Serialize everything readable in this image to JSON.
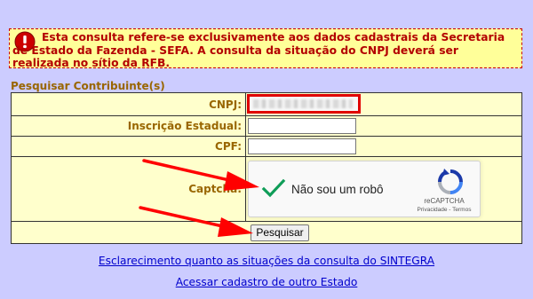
{
  "warning": {
    "icon": "exclamation-icon",
    "text": "Esta consulta refere-se exclusivamente aos dados cadastrais da Secretaria de Estado da Fazenda - SEFA. A consulta da situação do CNPJ deverá ser realizada no sítio da RFB."
  },
  "section_title": "Pesquisar Contribuinte(s)",
  "form": {
    "cnpj_label": "CNPJ:",
    "ie_label": "Inscrição Estadual:",
    "cpf_label": "CPF:",
    "captcha_label": "Captcha:",
    "submit_label": "Pesquisar"
  },
  "recaptcha": {
    "label": "Não sou um robô",
    "brand": "reCAPTCHA",
    "links": "Privacidade - Termos",
    "check_color": "#0f9d58"
  },
  "links": {
    "sintegra": "Esclarecimento quanto as situações da consulta do SINTEGRA",
    "outro_estado": "Acessar cadastro de outro Estado"
  },
  "colors": {
    "background": "#ccccff",
    "warning_bg": "#ffff99",
    "warning_text": "#b30000",
    "label_text": "#996600",
    "table_bg": "#ffffcc",
    "highlight": "#e00000",
    "link": "#0000cc"
  }
}
